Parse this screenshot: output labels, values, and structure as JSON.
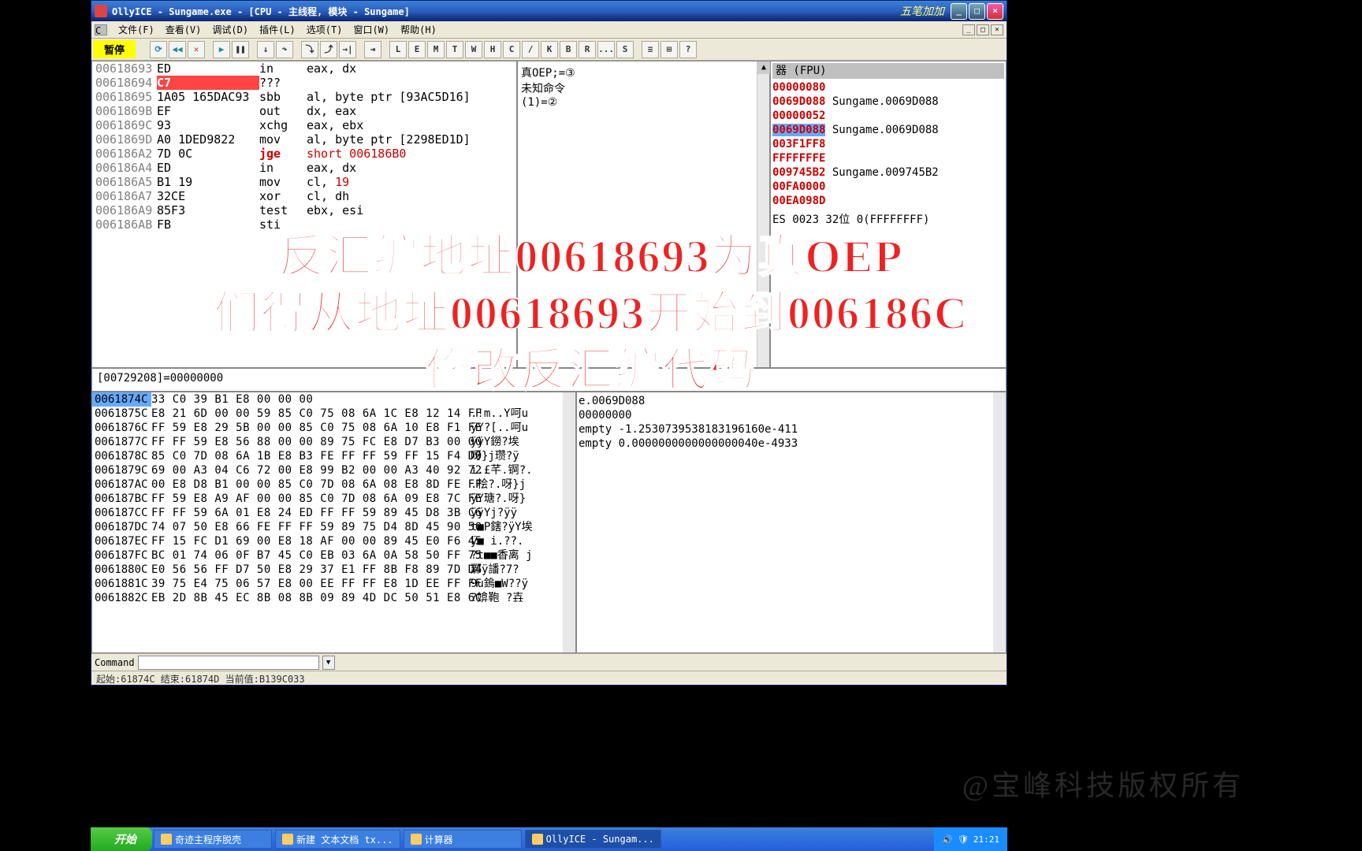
{
  "title": "OllyICE - Sungame.exe - [CPU - 主线程, 模块 - Sungame]",
  "banner": "五笔加加",
  "menu": {
    "file": "文件(F)",
    "view": "查看(V)",
    "debug": "调试(D)",
    "plugins": "插件(L)",
    "options": "选项(T)",
    "window": "窗口(W)",
    "help": "帮助(H)"
  },
  "pause": "暂停",
  "tbtns": [
    "L",
    "E",
    "M",
    "T",
    "W",
    "H",
    "C",
    "/",
    "K",
    "B",
    "R",
    "...",
    "S"
  ],
  "disasm": [
    {
      "addr": "00618693",
      "hex": "ED",
      "op": "in",
      "args": "eax, dx",
      "hl": false
    },
    {
      "addr": "00618694",
      "hex": "C7",
      "op": "???",
      "args": "",
      "hl": true
    },
    {
      "addr": "00618695",
      "hex": "1A05 165DAC93",
      "op": "sbb",
      "args": "al, byte ptr [93AC5D16]"
    },
    {
      "addr": "0061869B",
      "hex": "EF",
      "op": "out",
      "args": "dx, eax"
    },
    {
      "addr": "0061869C",
      "hex": "93",
      "op": "xchg",
      "args": "eax, ebx"
    },
    {
      "addr": "0061869D",
      "hex": "A0 1DED9822",
      "op": "mov",
      "args": "al, byte ptr [2298ED1D]"
    },
    {
      "addr": "006186A2",
      "hex": "7D 0C",
      "op": "jge",
      "args": "short 006186B0",
      "jmp": true
    },
    {
      "addr": "006186A4",
      "hex": "ED",
      "op": "in",
      "args": "eax, dx"
    },
    {
      "addr": "006186A5",
      "hex": "B1 19",
      "op": "mov",
      "args": "cl, 19",
      "imm": true
    },
    {
      "addr": "006186A7",
      "hex": "32CE",
      "op": "xor",
      "args": "cl, dh"
    },
    {
      "addr": "006186A9",
      "hex": "85F3",
      "op": "test",
      "args": "ebx, esi"
    },
    {
      "addr": "006186AB",
      "hex": "FB",
      "op": "sti",
      "args": ""
    }
  ],
  "comment": {
    "l1": "真OEP;=③",
    "l2": "未知命令",
    "l3": "(1)=②"
  },
  "regs_hdr": "器 (FPU)",
  "regs": [
    {
      "v": "00000080",
      "n": ""
    },
    {
      "v": "0069D088",
      "n": "Sungame.0069D088"
    },
    {
      "v": "00000052",
      "n": ""
    },
    {
      "v": "0069D088",
      "n": "Sungame.0069D088",
      "sel": true
    },
    {
      "v": "003F1FF8",
      "n": ""
    },
    {
      "v": "FFFFFFFE",
      "n": ""
    },
    {
      "v": "009745B2",
      "n": "Sungame.009745B2"
    },
    {
      "v": "00FA0000",
      "n": ""
    },
    {
      "v": "",
      "n": ""
    },
    {
      "v": "00EA098D",
      "n": ""
    }
  ],
  "regs_extra": "ES 0023 32位 0(FFFFFFFF)",
  "fpu": [
    "empty -1.2530739538183196160e-411",
    "empty 0.0000000000000000040e-4933"
  ],
  "midinfo": "[00729208]=00000000",
  "hex": [
    {
      "a": "0061874C",
      "b": "33 C0 39 B1 E8 00 00 00",
      "c": "",
      "sel": true
    },
    {
      "a": "0061875C",
      "b": "E8 21 6D 00 00 59 85 C0 75 08 6A 1C E8 12 14 FF",
      "c": ".!m..Y呵u"
    },
    {
      "a": "0061876C",
      "b": "FF 59 E8 29 5B 00 00 85 C0 75 08 6A 10 E8 F1 FE",
      "c": "ÿY?[..呵u"
    },
    {
      "a": "0061877C",
      "b": "FF FF 59 E8 56 88 00 00 89 75 FC E8 D7 B3 00 00",
      "c": "ÿÿY鐒?埃"
    },
    {
      "a": "0061878C",
      "b": "85 C0 7D 08 6A 1B E8 B3 FE FF FF 59 FF 15 F4 D0",
      "c": "呀}j瓒?ÿ"
    },
    {
      "a": "0061879C",
      "b": "69 00 A3 04 C6 72 00 E8 99 B2 00 00 A3 40 92 72",
      "c": "i.£芊.锕?."
    },
    {
      "a": "006187AC",
      "b": "00 E8 D8 B1 00 00 85 C0 7D 08 6A 08 E8 8D FE FF",
      "c": ".桧?.呀}j"
    },
    {
      "a": "006187BC",
      "b": "FF 59 E8 A9 AF 00 00 85 C0 7D 08 6A 09 E8 7C FE",
      "c": "ÿY瑭?.呀}"
    },
    {
      "a": "006187CC",
      "b": "FF FF 59 6A 01 E8 24 ED FF FF 59 89 45 D8 3B C6",
      "c": "ÿÿYj?ÿÿ"
    },
    {
      "a": "006187DC",
      "b": "74 07 50 E8 66 FE FF FF 59 89 75 D4 8D 45 90 50",
      "c": "t■P鎋?ÿY埃"
    },
    {
      "a": "006187EC",
      "b": "FF 15 FC D1 69 00 E8 18 AF 00 00 89 45 E0 F6 45",
      "c": "ÿ■ i.??."
    },
    {
      "a": "006187FC",
      "b": "BC 01 74 06 0F B7 45 C0 EB 03 6A 0A 58 50 FF 75",
      "c": "?t■■香离 j"
    },
    {
      "a": "0061880C",
      "b": "E0 56 56 FF D7 50 E8 29 37 E1 FF 8B F8 89 7D D4",
      "c": "鄴ÿ譒?7?"
    },
    {
      "a": "0061881C",
      "b": "39 75 E4 75 06 57 E8 00 EE FF FF E8 1D EE FF FF",
      "c": "9u鎢■W??ÿ"
    },
    {
      "a": "0061882C",
      "b": "EB 2D 8B 45 EC 8B 08 8B 09 89 4D DC 50 51 E8 6C",
      "c": "?媕鞄 ?壵"
    }
  ],
  "stack": [
    {
      "a": "",
      "b": "e.0069D088"
    },
    {
      "a": "",
      "b": "00000000"
    }
  ],
  "cmd_label": "Command",
  "statusline": "起始:61874C 结束:61874D 当前值:B139C033",
  "taskbar": {
    "start": "开始",
    "items": [
      {
        "t": "奇迹主程序脱壳",
        "active": false
      },
      {
        "t": "新建 文本文档 tx...",
        "active": false
      },
      {
        "t": "计算器",
        "active": false
      },
      {
        "t": "OllyICE - Sungam...",
        "active": true
      }
    ],
    "clock": "21:21"
  },
  "overlay": {
    "l1": "反汇编地址00618693为真OEP",
    "l2": "们得从地址00618693开始到006186C",
    "l3": "修改反汇编代码"
  },
  "watermark": "@宝峰科技版权所有"
}
